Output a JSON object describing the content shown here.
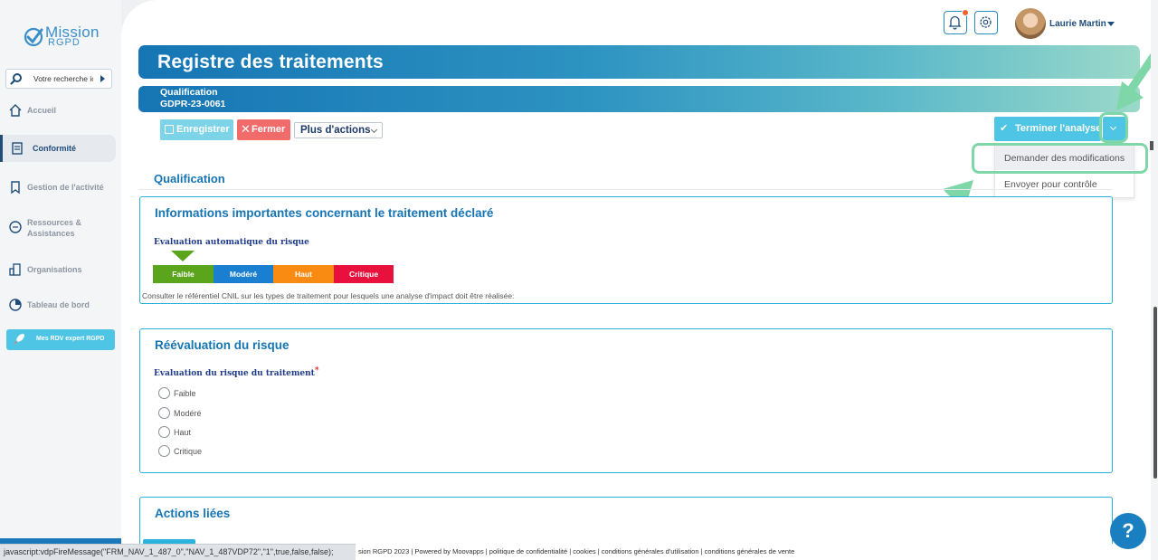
{
  "app": {
    "logo_text_1": "Mission",
    "logo_text_2": "RGPD"
  },
  "sidebar": {
    "search_placeholder": "Votre recherche ic",
    "items": [
      {
        "label": "Accueil",
        "icon": "home-icon"
      },
      {
        "label": "Conformité",
        "icon": "document-icon",
        "active": true
      },
      {
        "label": "Gestion de l'activité",
        "icon": "bookmark-icon"
      },
      {
        "label": "Ressources & Assistances",
        "icon": "chat-icon"
      },
      {
        "label": "Organisations",
        "icon": "building-icon"
      },
      {
        "label": "Tableau de bord",
        "icon": "dashboard-icon"
      }
    ],
    "rdv_button": "Mes RDV expert RGPD"
  },
  "header": {
    "username": "Laurie Martin",
    "notification_dot_color": "#f0622b"
  },
  "page": {
    "title": "Registre des traitements",
    "subtitle_1": "Qualification",
    "subtitle_2": "GDPR-23-0061"
  },
  "toolbar": {
    "save_label": "Enregistrer",
    "close_label": "Fermer",
    "more_label": "Plus d'actions",
    "finish_label": "Terminer l'analyse",
    "dropdown": {
      "item_1": "Demander des modifications",
      "item_2": "Envoyer pour contrôle"
    }
  },
  "section": {
    "title": "Qualification"
  },
  "card_info": {
    "title": "Informations importantes concernant le traitement déclaré",
    "field_label": "Evaluation automatique du risque",
    "risk_levels": [
      {
        "label": "Faible",
        "color": "#5aa51b"
      },
      {
        "label": "Modéré",
        "color": "#1a7fd1"
      },
      {
        "label": "Haut",
        "color": "#f98a12"
      },
      {
        "label": "Critique",
        "color": "#e8103c"
      }
    ],
    "selected_level": "Faible",
    "note": "Consulter le référentiel CNIL sur les types de traitement pour lesquels une analyse d'impact doit être réalisée:"
  },
  "card_reeval": {
    "title": "Réévaluation du risque",
    "field_label": "Evaluation du risque du traitement",
    "required_mark": "*",
    "options": [
      "Faible",
      "Modéré",
      "Haut",
      "Critique"
    ]
  },
  "card_actions": {
    "title": "Actions liées"
  },
  "footer": {
    "text": "sion RGPD 2023 | Powered by Moovapps | politique de confidentialité | cookies | conditions générales d'utilisation | conditions générales de vente"
  },
  "statusbar": {
    "text": "javascript:vdpFireMessage(\"FRM_NAV_1_487_0\",\"NAV_1_487VDP72\",\"1\",true,false,false);"
  },
  "help": {
    "label": "?"
  },
  "colors": {
    "accent": "#1675b4",
    "highlight": "#7fd6a8",
    "button_cyan": "#4ec5e4"
  }
}
